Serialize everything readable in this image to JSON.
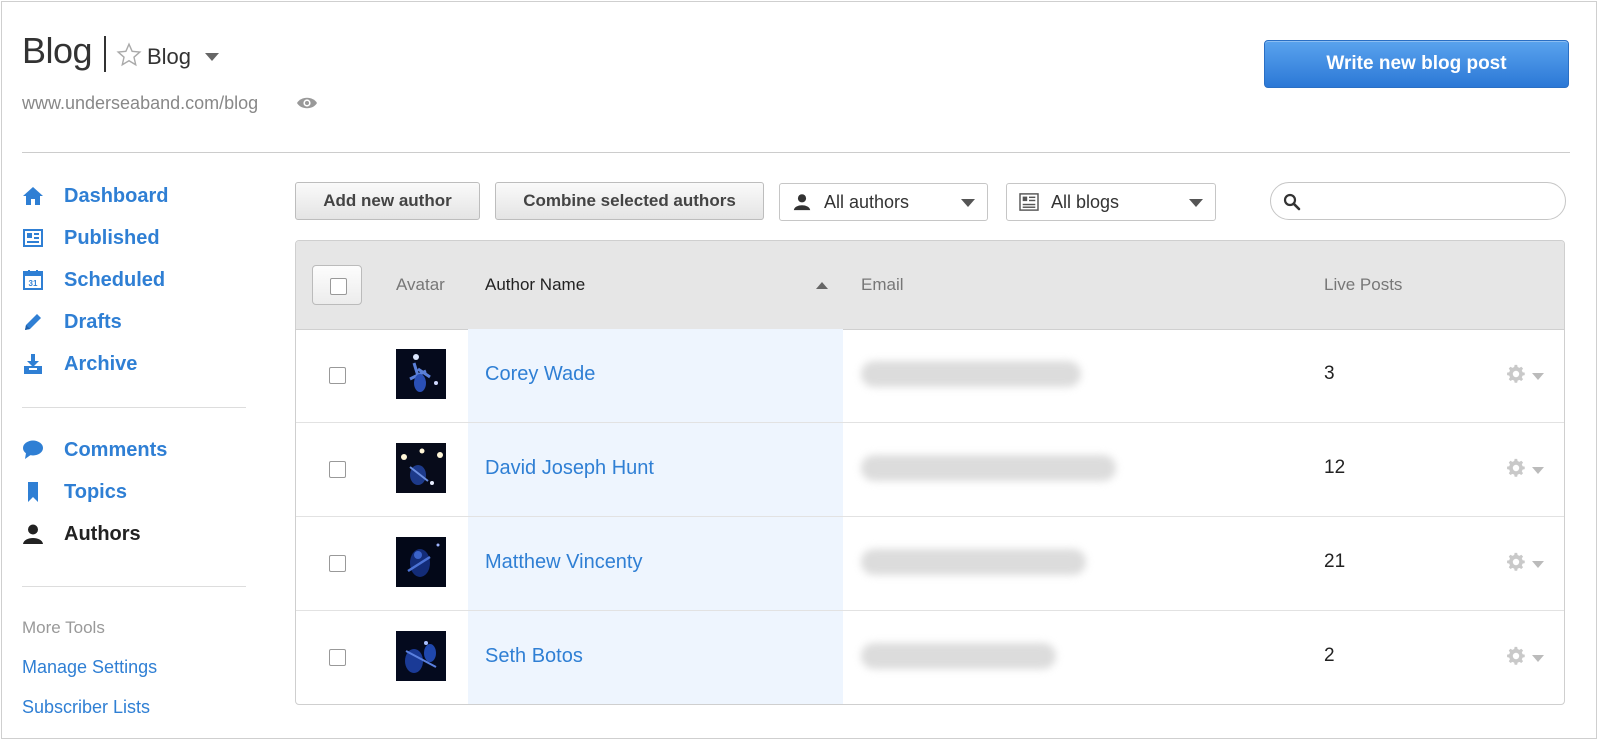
{
  "header": {
    "title": "Blog",
    "blog_switch_label": "Blog",
    "url": "www.underseaband.com/blog",
    "write_button": "Write new blog post"
  },
  "sidebar": {
    "items": [
      {
        "label": "Dashboard",
        "icon": "home-icon"
      },
      {
        "label": "Published",
        "icon": "published-icon"
      },
      {
        "label": "Scheduled",
        "icon": "calendar-icon",
        "icon_text": "31"
      },
      {
        "label": "Drafts",
        "icon": "pencil-icon"
      },
      {
        "label": "Archive",
        "icon": "archive-icon"
      },
      {
        "label": "Comments",
        "icon": "comment-icon"
      },
      {
        "label": "Topics",
        "icon": "bookmark-icon"
      },
      {
        "label": "Authors",
        "icon": "user-icon",
        "active": true
      }
    ],
    "more_tools_label": "More Tools",
    "links": [
      "Manage Settings",
      "Subscriber Lists"
    ]
  },
  "toolbar": {
    "add_author": "Add new author",
    "combine_authors": "Combine selected authors",
    "authors_filter": "All authors",
    "blogs_filter": "All blogs",
    "search_placeholder": ""
  },
  "table": {
    "columns": {
      "avatar": "Avatar",
      "name": "Author Name",
      "email": "Email",
      "posts": "Live Posts"
    },
    "rows": [
      {
        "name": "Corey Wade",
        "posts": "3"
      },
      {
        "name": "David Joseph Hunt",
        "posts": "12"
      },
      {
        "name": "Matthew Vincenty",
        "posts": "21"
      },
      {
        "name": "Seth Botos",
        "posts": "2"
      }
    ]
  },
  "colors": {
    "accent": "#2f7fd4",
    "primary_button": "#2b78d6",
    "name_column_highlight": "#eef5fe"
  }
}
